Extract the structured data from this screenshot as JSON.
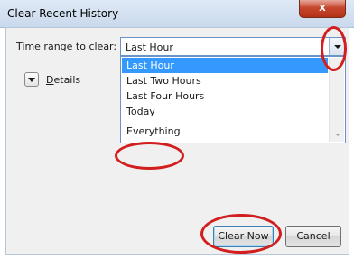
{
  "window": {
    "title": "Clear Recent History",
    "close_glyph": "x"
  },
  "time_range": {
    "label_underlined": "T",
    "label_rest": "ime range to clear:",
    "selected_value": "Last Hour",
    "options": [
      {
        "label": "Last Hour",
        "selected": true
      },
      {
        "label": "Last Two Hours",
        "selected": false
      },
      {
        "label": "Last Four Hours",
        "selected": false
      },
      {
        "label": "Today",
        "selected": false
      },
      {
        "label": "Everything",
        "selected": false
      }
    ]
  },
  "details": {
    "label_underlined": "D",
    "label_rest": "etails"
  },
  "buttons": {
    "clear_now": "Clear Now",
    "cancel": "Cancel"
  },
  "colors": {
    "highlight": "#3399ff",
    "annotation": "#d21e1e"
  }
}
